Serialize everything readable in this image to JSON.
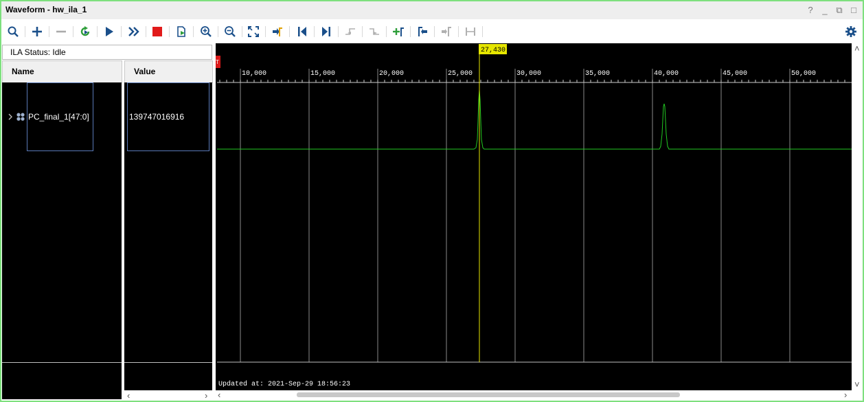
{
  "window": {
    "title": "Waveform - hw_ila_1",
    "controls": [
      "?",
      "_",
      "⧉",
      "□"
    ]
  },
  "status": {
    "text": "ILA Status:  Idle"
  },
  "columns": {
    "name": "Name",
    "value": "Value"
  },
  "signal": {
    "name": "PC_final_1[47:0]",
    "value": "139747016916"
  },
  "waveform": {
    "cursor_label": "27,430",
    "marker_label": "T",
    "updated_text": "Updated at: 2021-Sep-29 18:56:23",
    "ticks": [
      "10,000",
      "15,000",
      "20,000",
      "25,000",
      "30,000",
      "35,000",
      "40,000",
      "45,000",
      "50,000"
    ],
    "colors": {
      "background": "#000000",
      "trace": "#22c922",
      "cursor": "#e6e600",
      "grid": "#8a8a8a"
    }
  }
}
